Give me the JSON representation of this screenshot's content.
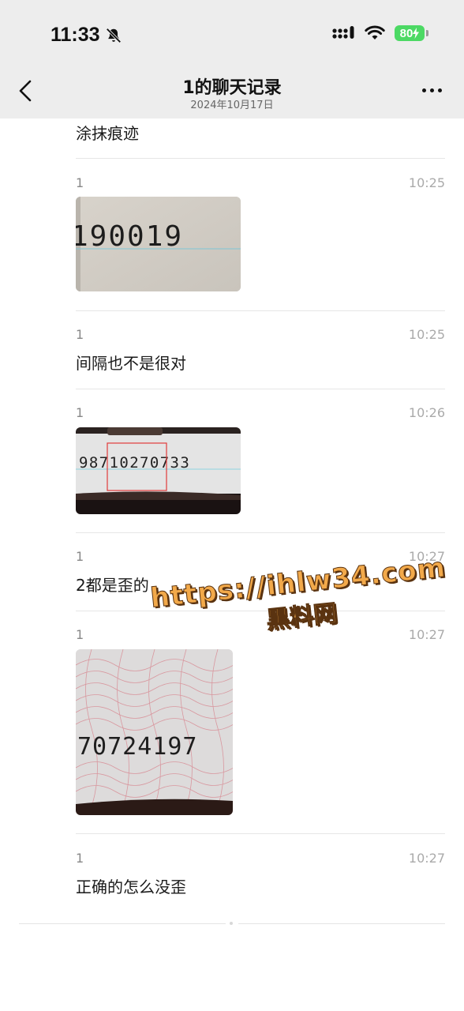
{
  "status_bar": {
    "time": "11:33",
    "battery": "80"
  },
  "header": {
    "title": "1的聊天记录",
    "subtitle": "2024年10月17日"
  },
  "messages": [
    {
      "sender": "",
      "time": "",
      "text": "涂抹痕迹"
    },
    {
      "sender": "1",
      "time": "10:25",
      "image_text": "190019"
    },
    {
      "sender": "1",
      "time": "10:25",
      "text": "间隔也不是很对"
    },
    {
      "sender": "1",
      "time": "10:26",
      "image_text": "98710270733"
    },
    {
      "sender": "1",
      "time": "10:27",
      "text": "2都是歪的"
    },
    {
      "sender": "1",
      "time": "10:27",
      "image_text": "70724197"
    },
    {
      "sender": "1",
      "time": "10:27",
      "text": "正确的怎么没歪"
    }
  ],
  "watermark": {
    "line1": "https://ihlw34.com",
    "line2": "黑料网"
  },
  "colors": {
    "header_bg": "#ededed",
    "battery": "#4cd964",
    "watermark": "#f2a94a"
  }
}
